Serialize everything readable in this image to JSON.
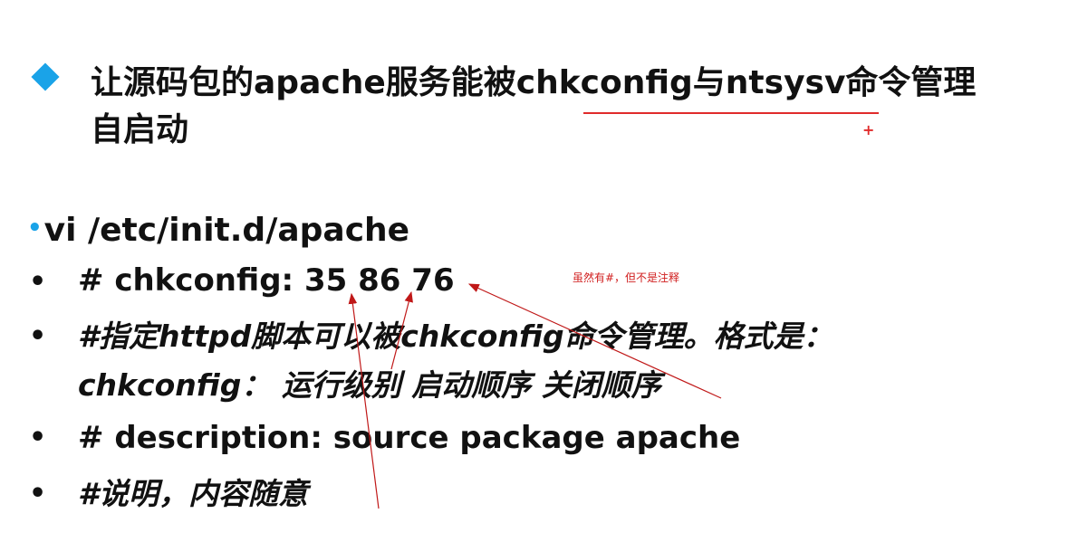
{
  "colors": {
    "accent": "#1aa3e8",
    "annotation": "#e02b2b"
  },
  "heading": {
    "line1": "让源码包的apache服务能被chkconfig与ntsysv命令管理",
    "line2": "自启动"
  },
  "command": {
    "bullet": "•",
    "text": "vi /etc/init.d/apache"
  },
  "items": [
    {
      "bullet": "•",
      "text": "# chkconfig: 35 86 76"
    },
    {
      "bullet": "•",
      "text": "#指定httpd脚本可以被chkconfig命令管理。格式是："
    },
    {
      "bullet": "",
      "text": "chkconfig： 运行级别 启动顺序 关闭顺序"
    },
    {
      "bullet": "•",
      "text": "# description: source package apache"
    },
    {
      "bullet": "•",
      "text": "#说明，内容随意"
    }
  ],
  "annotation": {
    "note": "虽然有#，但不是注释",
    "plus": "+"
  }
}
